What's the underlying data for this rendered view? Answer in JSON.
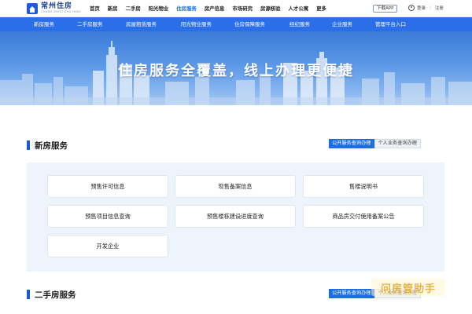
{
  "header": {
    "logo_cn": "常州住房",
    "logo_en": "CHANG ZHOU ZHU FANG",
    "nav": [
      "首页",
      "新房",
      "二手房",
      "阳光物业",
      "住房服务",
      "房产信息",
      "市场研究",
      "房源核验",
      "人才公寓",
      "更多"
    ],
    "active_nav_index": 4,
    "download_app": "下载APP",
    "login": "登录",
    "register": "注册"
  },
  "subnav": [
    "新房服务",
    "二手房服务",
    "房屋租赁服务",
    "阳光物业服务",
    "住房保障服务",
    "经纪服务",
    "企业服务",
    "管理平台入口"
  ],
  "banner": {
    "title": "住房服务全覆盖，线上办理更便捷"
  },
  "sections": [
    {
      "title": "新房服务",
      "tab_public": "公开服务查询办理",
      "tab_personal": "个人业务查询办理",
      "cards": [
        "预售许可信息",
        "现售备案信息",
        "售楼说明书",
        "预售项目信息查询",
        "预售楼栋建设进度查询",
        "商品房交付使用备案公告",
        "开发企业"
      ]
    },
    {
      "title": "二手房服务",
      "tab_public": "公开服务查询办理",
      "tab_personal": "个人业务查询办理"
    }
  ],
  "watermark": "问房管助手",
  "colors": {
    "primary": "#1d6fe0",
    "subnav_bg": "#2a6fe8",
    "panel_bg": "#eef4fb"
  }
}
